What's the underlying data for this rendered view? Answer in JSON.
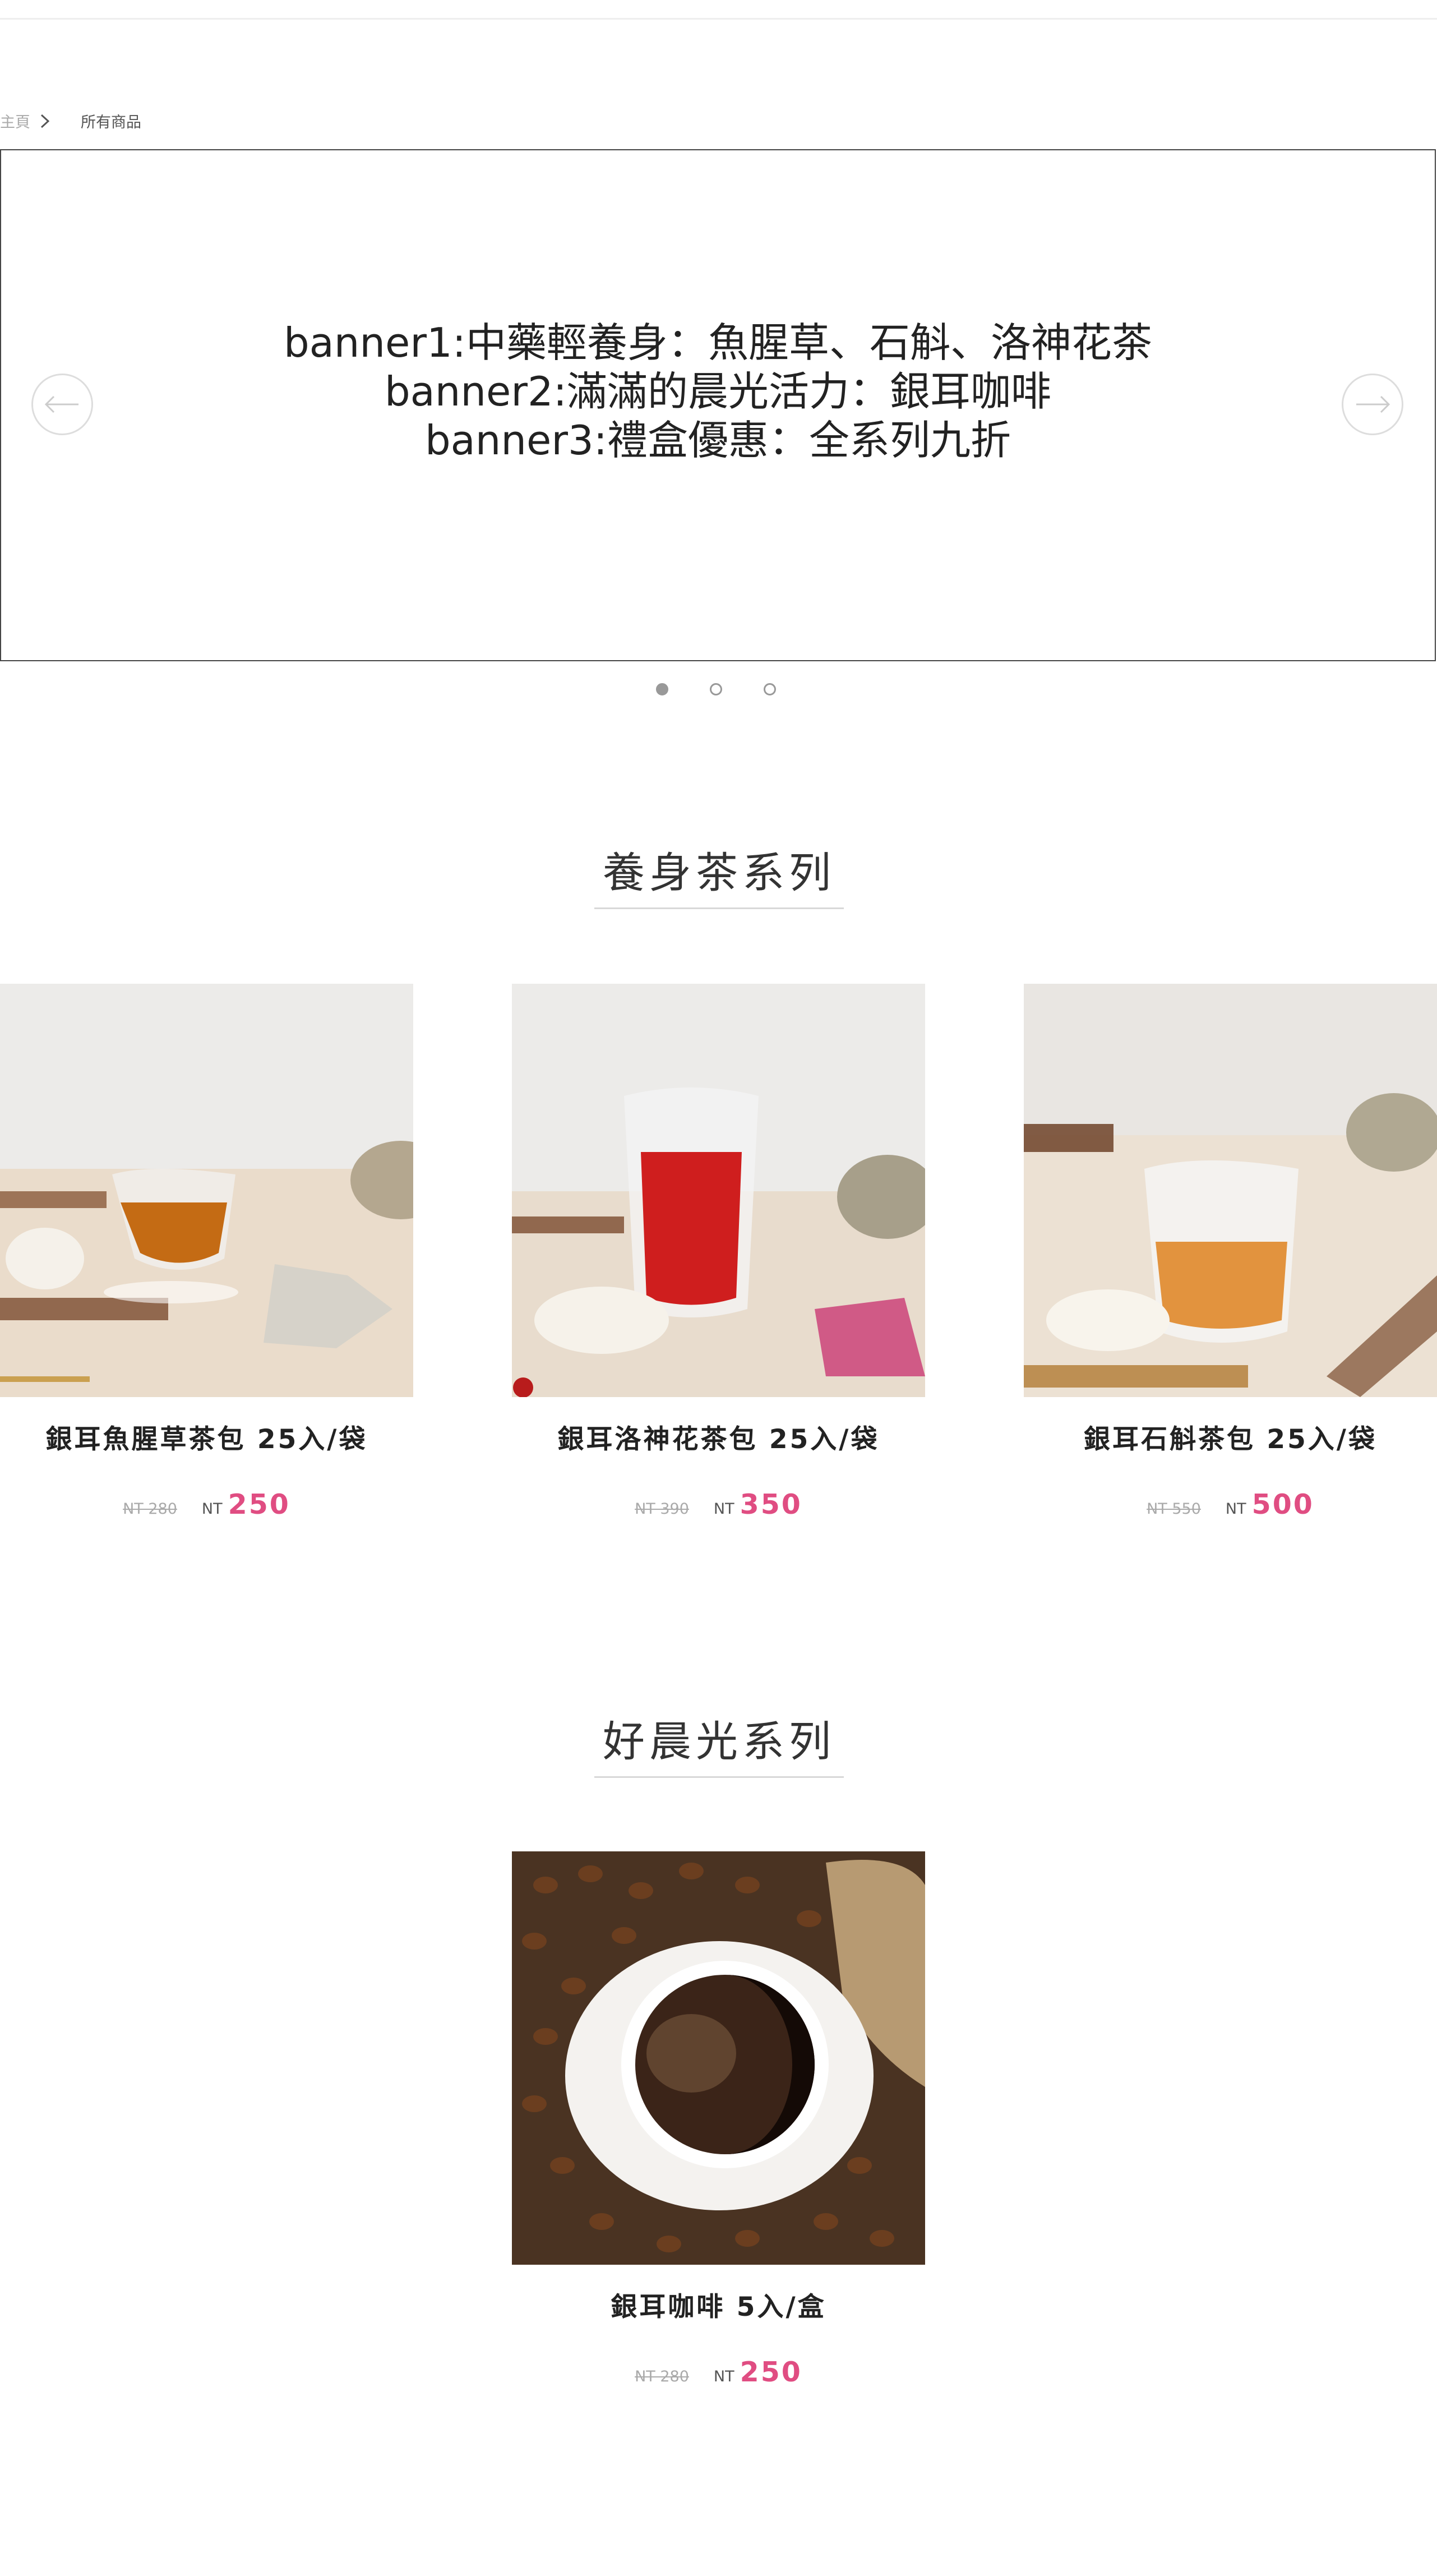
{
  "breadcrumb": {
    "home": "主頁",
    "current": "所有商品"
  },
  "banner": {
    "lines": [
      "banner1:中藥輕養身：魚腥草、石斛、洛神花茶",
      "banner2:滿滿的晨光活力：銀耳咖啡",
      "banner3:禮盒優惠：全系列九折"
    ],
    "active_slide": 1,
    "slide_count": 3
  },
  "sections": [
    {
      "title": "養身茶系列",
      "products": [
        {
          "name": "銀耳魚腥草茶包 25入/袋",
          "old_price": "NT 280",
          "currency": "NT",
          "price": "250"
        },
        {
          "name": "銀耳洛神花茶包 25入/袋",
          "old_price": "NT 390",
          "currency": "NT",
          "price": "350"
        },
        {
          "name": "銀耳石斛茶包 25入/袋",
          "old_price": "NT 550",
          "currency": "NT",
          "price": "500"
        }
      ]
    },
    {
      "title": "好晨光系列",
      "products": [
        {
          "name": "銀耳咖啡 5入/盒",
          "old_price": "NT 280",
          "currency": "NT",
          "price": "250"
        }
      ]
    }
  ],
  "colors": {
    "price_accent": "#e04d82",
    "text": "#222222"
  },
  "icons": {
    "prev": "arrow-left-icon",
    "next": "arrow-right-icon",
    "separator": "chevron-right-icon"
  }
}
